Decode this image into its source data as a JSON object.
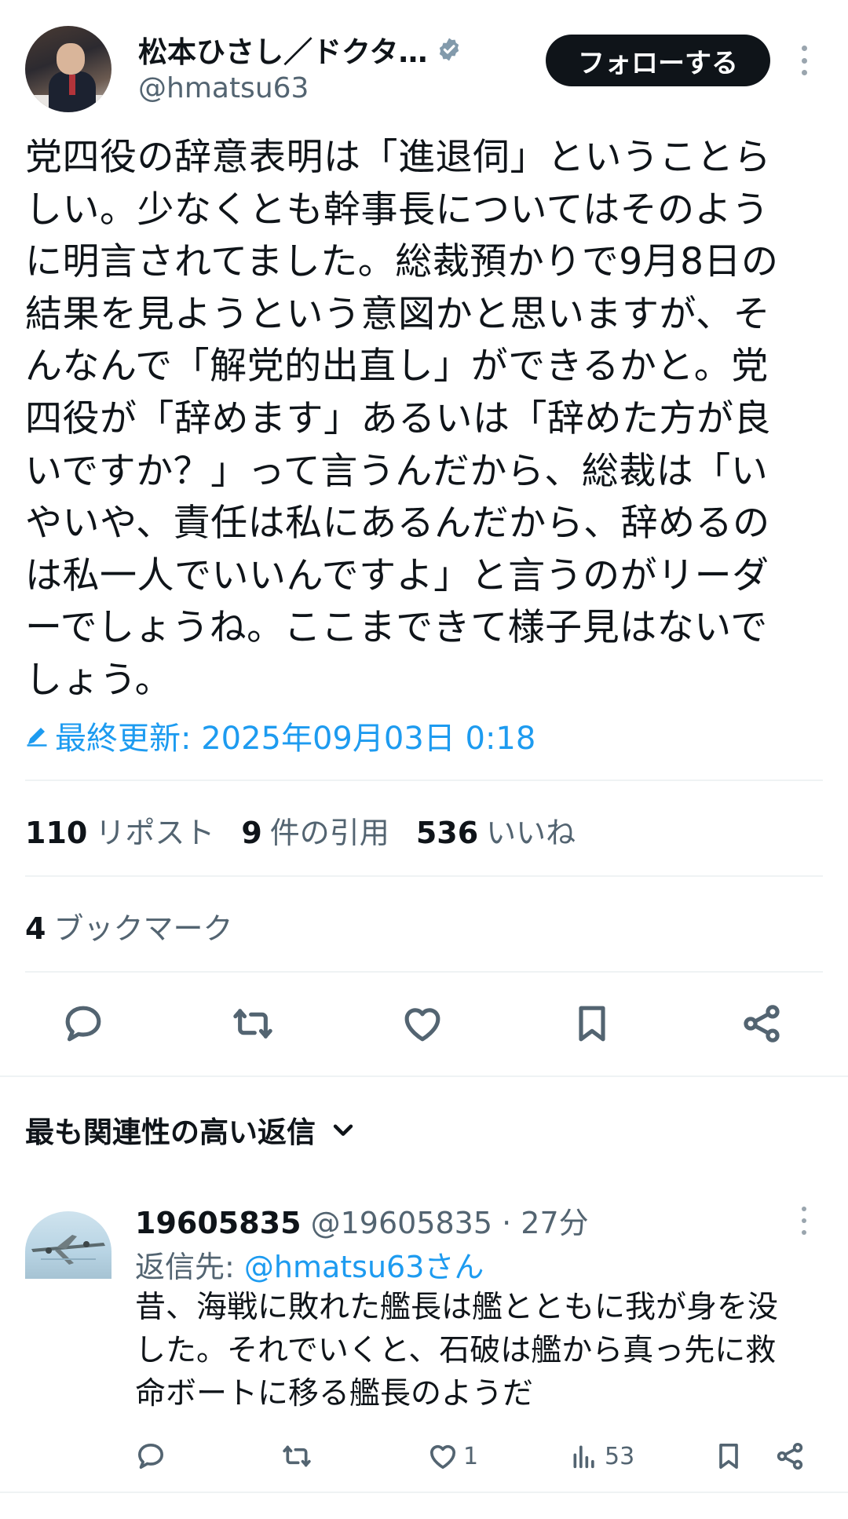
{
  "author": {
    "display_name": "松本ひさし／ドクタ…",
    "handle": "@hmatsu63",
    "verified_icon": "verified-badge-icon"
  },
  "follow_button": "フォローする",
  "tweet": {
    "text": "党四役の辞意表明は「進退伺」ということら\nしい。少なくとも幹事長についてはそのよう\nに明言されてました。総裁預かりで9月8日の\n結果を見ようという意図かと思いますが、そ\nんなんで「解党的出直し」ができるかと。党\n四役が「辞めます」あるいは「辞めた方が良\nいですか？」って言うんだから、総裁は「い\nやいや、責任は私にあるんだから、辞めるの\nは私一人でいいんですよ」と言うのがリーダ\nーでしょうね。ここまできて様子見はないで\nしょう。",
    "edited_label": "最終更新: 2025年09月03日 0:18"
  },
  "stats": {
    "reposts_count": "110",
    "reposts_label": "リポスト",
    "quotes_count": "9",
    "quotes_label": "件の引用",
    "likes_count": "536",
    "likes_label": "いいね",
    "bookmarks_count": "4",
    "bookmarks_label": "ブックマーク"
  },
  "replies_sort": {
    "label": "最も関連性の高い返信"
  },
  "reply": {
    "name": "19605835",
    "handle_time": "@19605835 · 27分",
    "reply_to_prefix": "返信先: ",
    "reply_to_handle": "@hmatsu63さん",
    "text": "昔、海戦に敗れた艦長は艦とともに我が身を没\nした。それでいくと、石破は艦から真っ先に救\n命ボートに移る艦長のようだ",
    "likes": "1",
    "views": "53"
  },
  "colors": {
    "accent": "#1d9bf0",
    "text": "#0f1419",
    "secondary": "#536471",
    "follow_bg": "#0f1419"
  }
}
